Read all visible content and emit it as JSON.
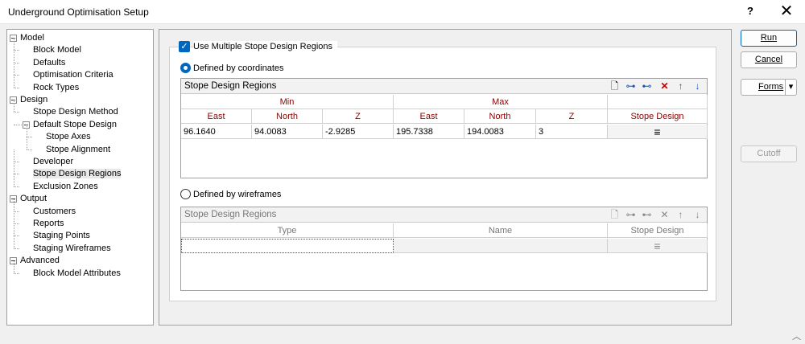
{
  "window": {
    "title": "Underground Optimisation Setup",
    "help": "?",
    "close": "✕"
  },
  "tree": [
    {
      "label": "Model",
      "level": 0
    },
    {
      "label": "Block Model",
      "level": 1
    },
    {
      "label": "Defaults",
      "level": 1
    },
    {
      "label": "Optimisation Criteria",
      "level": 1
    },
    {
      "label": "Rock Types",
      "level": 1
    },
    {
      "label": "Design",
      "level": 0
    },
    {
      "label": "Stope Design Method",
      "level": 1
    },
    {
      "label": "Default Stope Design",
      "level": 1
    },
    {
      "label": "Stope Axes",
      "level": 2
    },
    {
      "label": "Stope Alignment",
      "level": 2
    },
    {
      "label": "Developer",
      "level": 1
    },
    {
      "label": "Stope Design Regions",
      "level": 1,
      "selected": true
    },
    {
      "label": "Exclusion Zones",
      "level": 1
    },
    {
      "label": "Output",
      "level": 0
    },
    {
      "label": "Customers",
      "level": 1
    },
    {
      "label": "Reports",
      "level": 1
    },
    {
      "label": "Staging Points",
      "level": 1
    },
    {
      "label": "Staging Wireframes",
      "level": 1
    },
    {
      "label": "Advanced",
      "level": 0
    },
    {
      "label": "Block Model Attributes",
      "level": 1
    }
  ],
  "main": {
    "use_multiple_label": "Use Multiple Stope Design Regions",
    "use_multiple_checked": true,
    "radio_coords_label": "Defined by coordinates",
    "radio_wireframes_label": "Defined by wireframes",
    "selected_mode": "coordinates"
  },
  "coords_grid": {
    "title": "Stope Design Regions",
    "group_min": "Min",
    "group_max": "Max",
    "columns": [
      "East",
      "North",
      "Z",
      "East",
      "North",
      "Z",
      "Stope Design"
    ],
    "rows": [
      [
        "96.1640",
        "94.0083",
        "-2.9285",
        "195.7338",
        "194.0083",
        "3",
        "≡"
      ]
    ]
  },
  "wire_grid": {
    "title": "Stope Design Regions",
    "columns": [
      "Type",
      "Name",
      "Stope Design"
    ],
    "rows": [
      [
        "",
        "",
        "≡"
      ]
    ]
  },
  "buttons": {
    "run": "Run",
    "cancel": "Cancel",
    "forms": "Forms",
    "forms_arrow": "▾",
    "cutoff": "Cutoff"
  }
}
